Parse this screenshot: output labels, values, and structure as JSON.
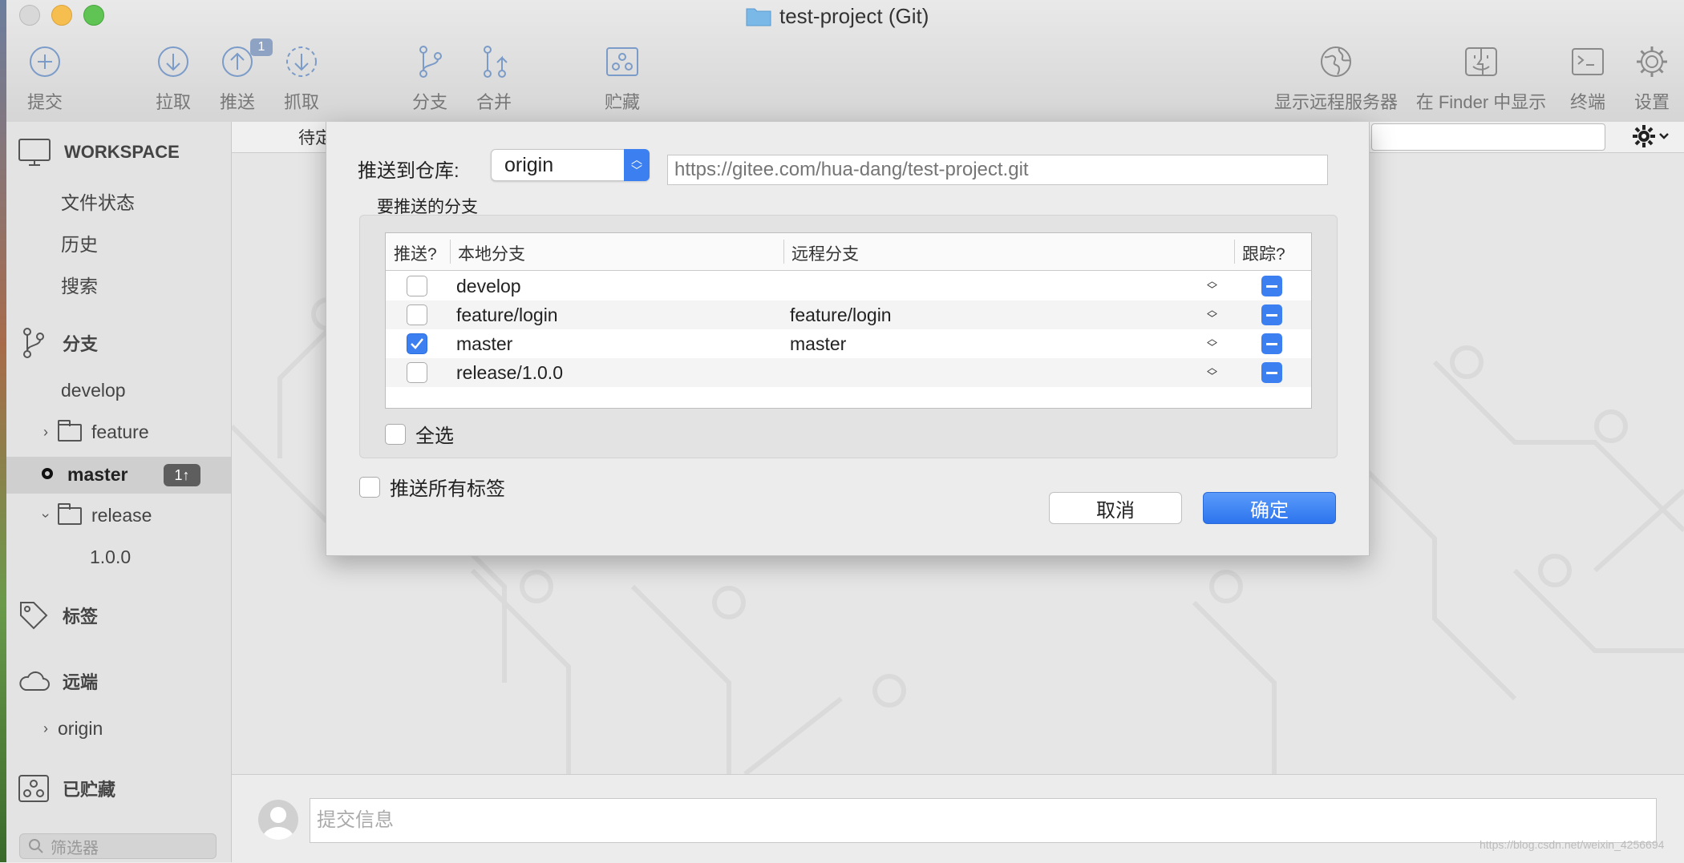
{
  "window": {
    "title": "test-project (Git)"
  },
  "toolbar": {
    "commit": "提交",
    "pull": "拉取",
    "push": "推送",
    "push_badge": "1",
    "fetch": "抓取",
    "branch": "分支",
    "merge": "合并",
    "stash": "贮藏",
    "show_remote": "显示远程服务器",
    "show_in_finder": "在 Finder 中显示",
    "terminal": "终端",
    "settings": "设置"
  },
  "sidebar": {
    "workspace": "WORKSPACE",
    "file_status": "文件状态",
    "history": "历史",
    "search": "搜索",
    "branches": "分支",
    "branch_develop": "develop",
    "folder_feature": "feature",
    "branch_master": "master",
    "master_badge": "1↑",
    "folder_release": "release",
    "branch_release_100": "1.0.0",
    "tags": "标签",
    "remotes": "远端",
    "remote_origin": "origin",
    "stashes": "已贮藏",
    "filter_placeholder": "筛选器"
  },
  "main": {
    "pending_label": "待定",
    "commit_placeholder": "提交信息",
    "watermark": "https://blog.csdn.net/weixin_4256694"
  },
  "dialog": {
    "push_to_label": "推送到仓库:",
    "remote": "origin",
    "remote_url": "https://gitee.com/hua-dang/test-project.git",
    "branches_label": "要推送的分支",
    "columns": {
      "push": "推送?",
      "local": "本地分支",
      "remote": "远程分支",
      "track": "跟踪?"
    },
    "rows": [
      {
        "local": "develop",
        "remote": "",
        "push": false
      },
      {
        "local": "feature/login",
        "remote": "feature/login",
        "push": false
      },
      {
        "local": "master",
        "remote": "master",
        "push": true
      },
      {
        "local": "release/1.0.0",
        "remote": "",
        "push": false
      }
    ],
    "select_all": "全选",
    "push_all_tags": "推送所有标签",
    "cancel": "取消",
    "ok": "确定"
  },
  "colors": {
    "accent": "#3b7ff0",
    "toolbar_icon": "#7b9bc8"
  }
}
